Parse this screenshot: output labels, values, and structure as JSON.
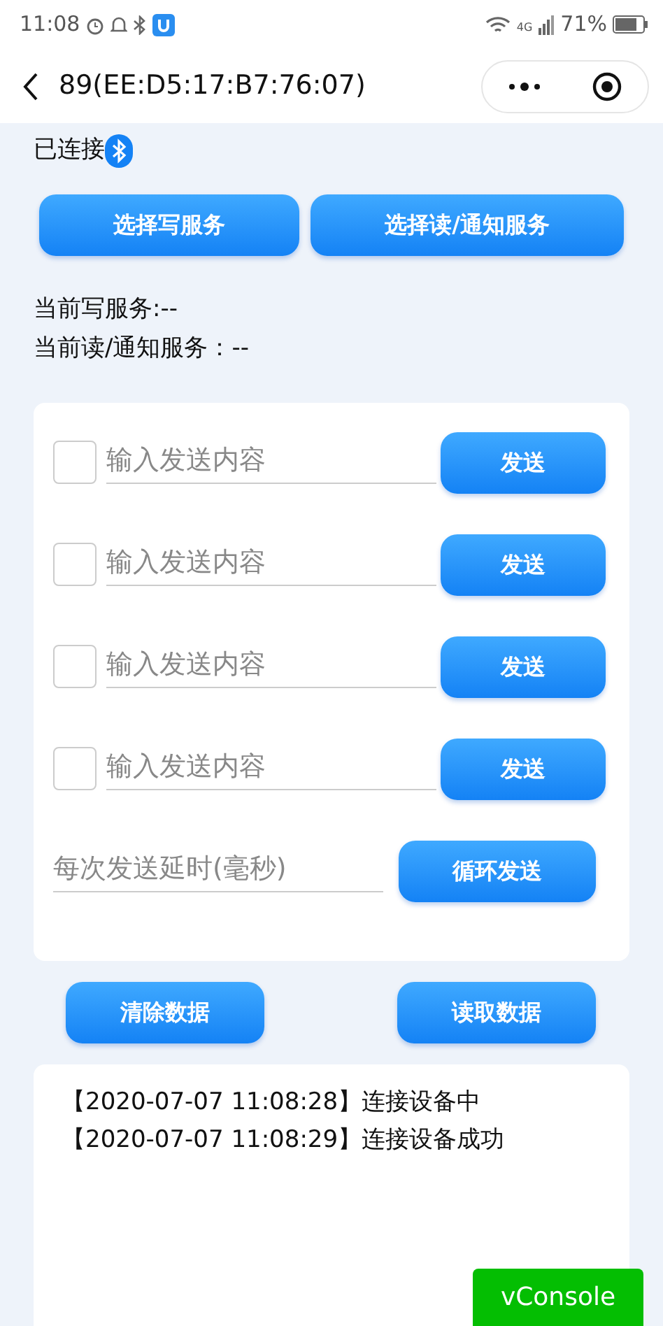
{
  "status_bar": {
    "time": "11:08",
    "network": "4G",
    "battery": "71%"
  },
  "nav": {
    "title": "89(EE:D5:17:B7:76:07)"
  },
  "connection": {
    "label": "已连接"
  },
  "service_buttons": [
    "选择写服务",
    "选择读/通知服务"
  ],
  "service_info": [
    "当前写服务:--",
    "当前读/通知服务：--"
  ],
  "send_rows": [
    {
      "checked": false,
      "placeholder": "输入发送内容",
      "button": "发送"
    },
    {
      "checked": false,
      "placeholder": "输入发送内容",
      "button": "发送"
    },
    {
      "checked": false,
      "placeholder": "输入发送内容",
      "button": "发送"
    },
    {
      "checked": false,
      "placeholder": "输入发送内容",
      "button": "发送"
    }
  ],
  "loop": {
    "placeholder": "每次发送延时(毫秒)",
    "button": "循环发送"
  },
  "data_buttons": [
    "清除数据",
    "读取数据"
  ],
  "log": [
    "【2020-07-07 11:08:28】连接设备中",
    "【2020-07-07 11:08:29】连接设备成功"
  ],
  "vconsole": {
    "label": "vConsole"
  }
}
